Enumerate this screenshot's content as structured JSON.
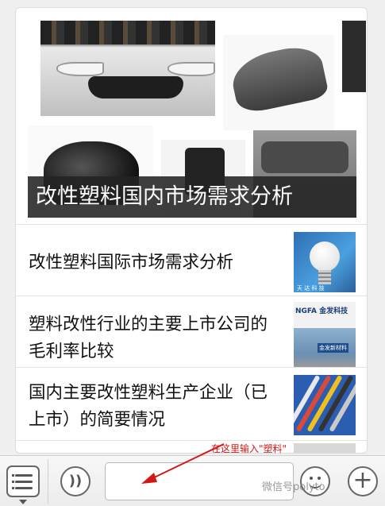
{
  "hero": {
    "caption": "改性塑料国内市场需求分析"
  },
  "articles": [
    {
      "title": "改性塑料国际市场需求分析",
      "thumb": "led-bulb-image"
    },
    {
      "title": "塑料改性行业的主要上市公司的毛利率比较",
      "thumb": "factory-image",
      "thumb_text": "NGFA 金发科技",
      "thumb_sign": "金发新材料"
    },
    {
      "title": "国内主要改性塑料生产企业（已上市）的简要情况",
      "thumb": "cable-image"
    }
  ],
  "annotation": {
    "text": "在这里输入\"塑料\"",
    "color": "#d01818"
  },
  "input_bar": {
    "menu_icon": "list-menu-icon",
    "voice_icon": "voice-icon",
    "voice_glyph": "))",
    "input_value": "",
    "emoji_icon": "emoji-icon",
    "plus_icon": "plus-icon",
    "plus_glyph": "+"
  },
  "watermark": "微信号polyto"
}
